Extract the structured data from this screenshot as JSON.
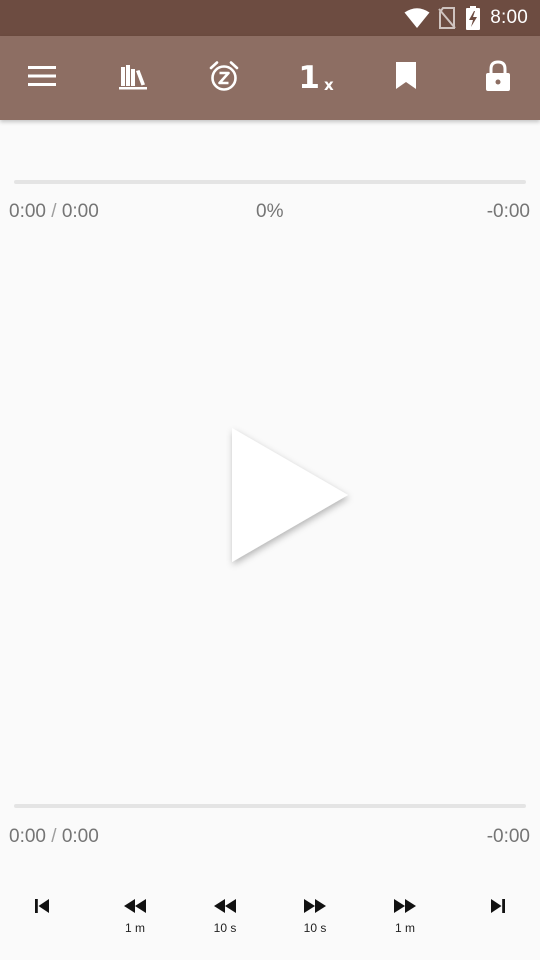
{
  "status_bar": {
    "time": "8:00",
    "icons": [
      "wifi-icon",
      "no-sim-icon",
      "battery-charging-icon"
    ]
  },
  "toolbar": {
    "items": [
      "menu-icon",
      "library-icon",
      "sleep-timer-icon",
      "playback-speed",
      "bookmark-icon",
      "lock-icon"
    ],
    "speed": {
      "value": "1",
      "unit": "x"
    }
  },
  "book_progress": {
    "elapsed": "0:00",
    "separator": "/",
    "total": "0:00",
    "percent": "0%",
    "remaining": "-0:00",
    "fraction": 0
  },
  "chapter_progress": {
    "elapsed": "0:00",
    "separator": "/",
    "total": "0:00",
    "remaining": "-0:00",
    "fraction": 0
  },
  "play_button": {
    "icon": "play-icon"
  },
  "controls": {
    "previous_chapter": {
      "icon": "skip-previous-icon"
    },
    "rewind_long": {
      "icon": "rewind-icon",
      "label": "1 m"
    },
    "rewind_short": {
      "icon": "rewind-icon",
      "label": "10 s"
    },
    "forward_short": {
      "icon": "fast-forward-icon",
      "label": "10 s"
    },
    "forward_long": {
      "icon": "fast-forward-icon",
      "label": "1 m"
    },
    "next_chapter": {
      "icon": "skip-next-icon"
    }
  },
  "colors": {
    "status_bar": "#6d4c41",
    "toolbar": "#8d6e63",
    "background": "#fafafa",
    "track": "#e4e4e4",
    "text_secondary": "#757575"
  }
}
